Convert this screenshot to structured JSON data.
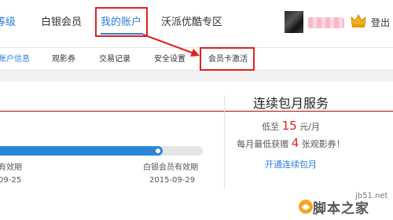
{
  "topnav": {
    "items": [
      "等级",
      "白银会员",
      "我的账户",
      "沃派优酷专区"
    ],
    "logout_label": "登出",
    "username_masked": "▒▒▒▒"
  },
  "subnav": {
    "items": [
      "账户信息",
      "观影券",
      "交易记录",
      "安全设置",
      "会员卡激活"
    ]
  },
  "membership": {
    "progress_fraction": 0.81,
    "left_label": "有效期",
    "left_date": "09-25",
    "right_label": "白银会员有效期",
    "right_date": "2015-09-29"
  },
  "service": {
    "title": "连续包月服务",
    "price_prefix": "低至",
    "price_value": "15",
    "price_suffix": "元/月",
    "bonus_prefix": "每月最低获赠",
    "bonus_value": "4",
    "bonus_suffix": "张观影券！",
    "link_label": "开通连续包月"
  },
  "watermark": {
    "url": "jb51.net",
    "logo_text": "脚本之家"
  },
  "colors": {
    "accent": "#2b7fd4",
    "highlight_box": "#e02020",
    "price": "#e02020"
  }
}
